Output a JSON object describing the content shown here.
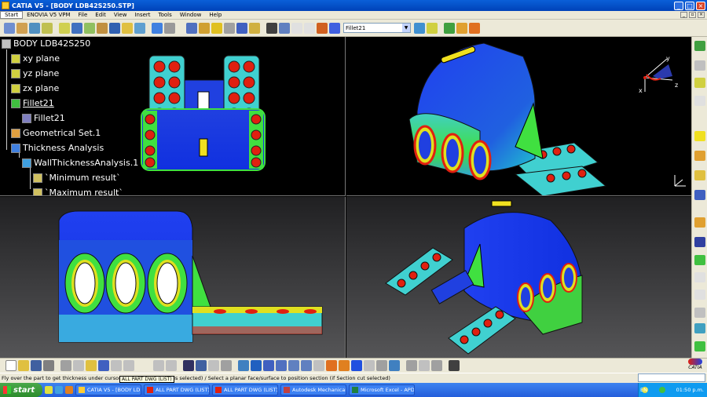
{
  "window": {
    "title": "CATIA V5 - [BODY LDB42S250.STP]"
  },
  "menu": [
    "Start",
    "ENOVIA V5 VPM",
    "File",
    "Edit",
    "View",
    "Insert",
    "Tools",
    "Window",
    "Help"
  ],
  "toolbar": {
    "combo_value": "Fillet21"
  },
  "spec_tree": {
    "root": "BODY LDB42S250",
    "xy": "xy plane",
    "yz": "yz plane",
    "zx": "zx plane",
    "fillet_group": "Fillet21",
    "fillet_child": "Fillet21",
    "geoset": "Geometrical Set.1",
    "thickness": "Thickness Analysis",
    "wall": "WallThicknessAnalysis.1",
    "min": "`Minimum result`",
    "max": "`Maximum result`"
  },
  "compass": {
    "x": "x",
    "y": "y",
    "z": "z"
  },
  "status": {
    "text": "Fly over the part to get thickness under cursor (if On the fly option is selected) / Select a planar face/surface to position section (if Section cut selected)",
    "tooltip": "ALL PART DWG (LIST)"
  },
  "taskbar": {
    "start": "start",
    "tasks": [
      "CATIA V5 - [BODY LD...",
      "ALL PART DWG (LIST)",
      "ALL PART DWG (LIST)",
      "Autodesk Mechanical ...",
      "Microsoft Excel - APDL"
    ],
    "lang": "EN",
    "clock": "01:50 p.m."
  },
  "logo": "CATIA",
  "colors": {
    "title_bar": "#0a5fd8",
    "thickness_blue": "#1030e0",
    "thickness_cyan": "#00c8e0",
    "thickness_green": "#40e040",
    "thickness_yellow": "#f0e020",
    "thickness_red": "#e02010"
  }
}
